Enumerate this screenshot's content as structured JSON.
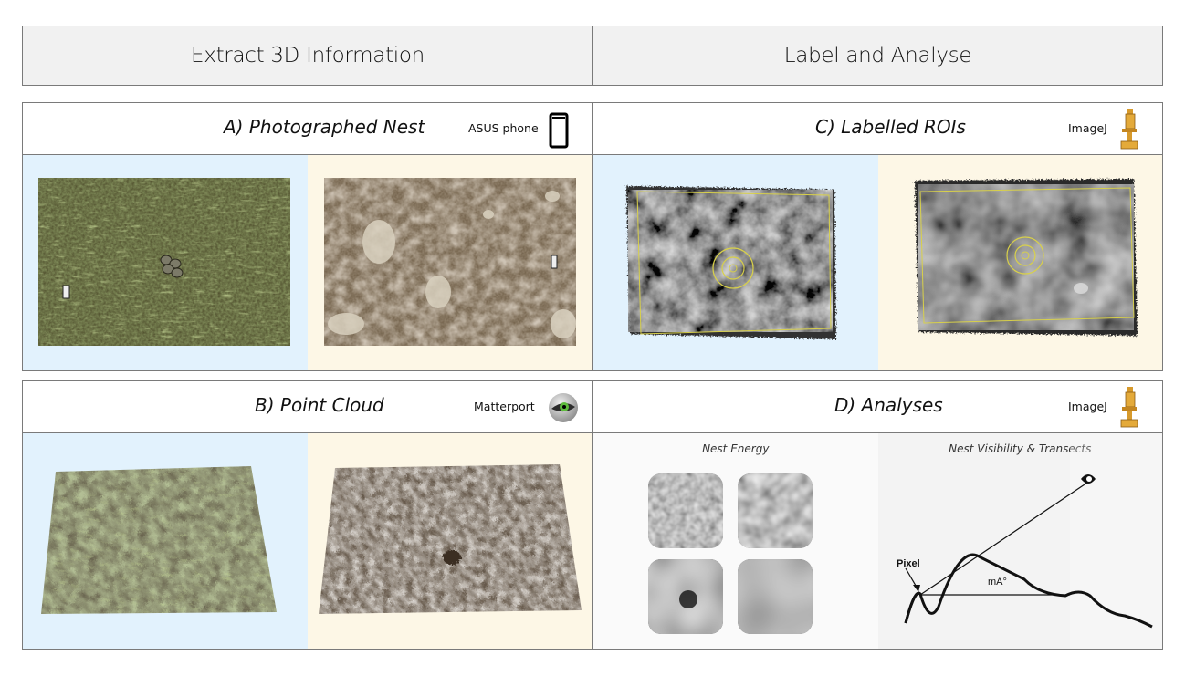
{
  "headers": {
    "left": "Extract 3D Information",
    "right": "Label and Analyse"
  },
  "panels": {
    "a": {
      "title": "A) Photographed Nest",
      "tool": "ASUS phone",
      "icon": "phone-icon"
    },
    "b": {
      "title": "B) Point Cloud",
      "tool": "Matterport",
      "icon": "eye-logo-icon"
    },
    "c": {
      "title": "C) Labelled ROIs",
      "tool": "ImageJ",
      "icon": "microscope-icon"
    },
    "d": {
      "title": "D) Analyses",
      "tool": "ImageJ",
      "icon": "microscope-icon",
      "energy_label": "Nest Energy",
      "visibility_label": "Nest Visibility & Transects",
      "pixel_label": "Pixel",
      "angle_label": "mA°"
    }
  },
  "colors": {
    "panel_blue": "#e2f2fd",
    "panel_cream": "#fdf7e6",
    "roi_yellow": "#d8d04a",
    "border": "#7a7a7a"
  }
}
